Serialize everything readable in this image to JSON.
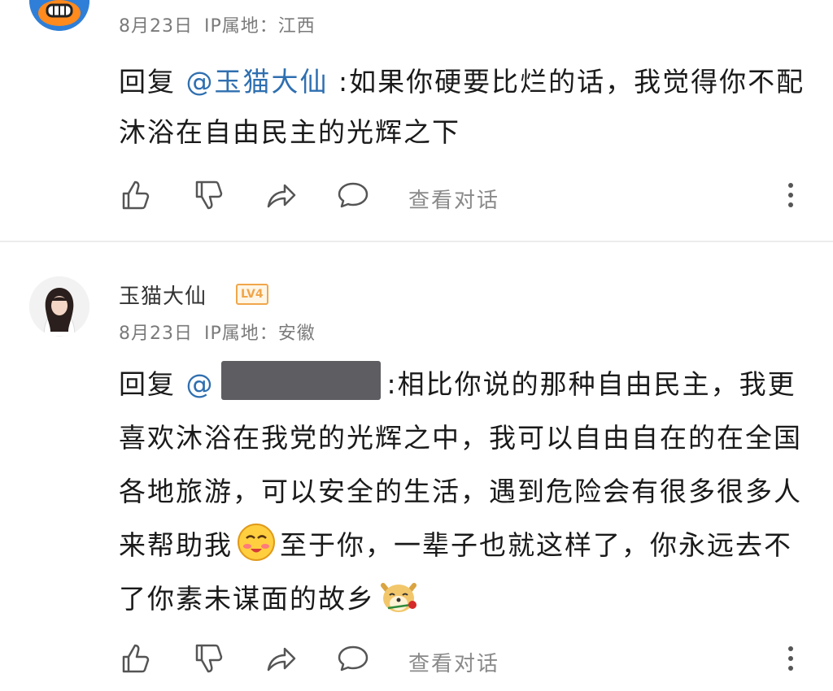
{
  "comments": [
    {
      "username": "",
      "date": "8月23日",
      "ip_label": "IP属地：",
      "ip_location": "江西",
      "reply_prefix": "回复",
      "mention": "@玉猫大仙",
      "body": ":如果你硬要比烂的话，我觉得你不配沐浴在自由民主的光辉之下",
      "actions": {
        "like_icon": "thumb-up-icon",
        "dislike_icon": "thumb-down-icon",
        "share_icon": "share-icon",
        "comment_icon": "comment-bubble-icon",
        "view_conversation": "查看对话",
        "more_icon": "more-vertical-icon"
      }
    },
    {
      "username": "玉猫大仙",
      "level_badge": "LV4",
      "date": "8月23日",
      "ip_label": "IP属地：",
      "ip_location": "安徽",
      "reply_prefix": "回复",
      "mention": "@",
      "body_part1": ":相比你说的那种自由民主，我更喜欢沐浴在我党的光辉之中，我可以自由自在的在全国各地旅游，可以安全的生活，遇到危险会有很多很多人来帮助我",
      "emoji1": "blushing-face-emoji",
      "body_part2": "至于你，一辈子也就这样了，你永远去不了你素未谋面的故乡",
      "emoji2": "dog-with-rose-emoji",
      "actions": {
        "like_icon": "thumb-up-icon",
        "dislike_icon": "thumb-down-icon",
        "share_icon": "share-icon",
        "comment_icon": "comment-bubble-icon",
        "view_conversation": "查看对话",
        "more_icon": "more-vertical-icon"
      }
    }
  ],
  "colors": {
    "mention": "#2f6fb0",
    "badge": "#f0a64a",
    "meta": "#7a7a7a"
  }
}
